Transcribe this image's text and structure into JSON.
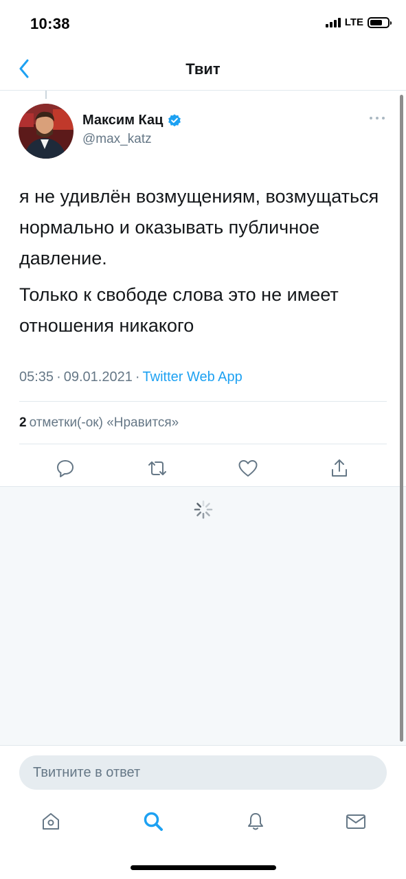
{
  "status_bar": {
    "time": "10:38",
    "network": "LTE"
  },
  "nav": {
    "title": "Твит"
  },
  "tweet": {
    "author_name": "Максим Кац",
    "author_handle": "@max_katz",
    "text_paragraphs": [
      "я не удивлён возмущениям, возмущаться нормально и оказывать публичное давление.",
      "Только к свободе слова это не имеет отношения никакого"
    ],
    "time": "05:35",
    "date": "09.01.2021",
    "source": "Twitter Web App",
    "likes_count": "2",
    "likes_label": "отметки(-ок) «Нравится»"
  },
  "reply": {
    "placeholder": "Твитните в ответ"
  },
  "icons": {
    "back": "chevron-left-icon",
    "verified": "verified-badge-icon",
    "more": "more-horizontal-icon",
    "reply": "reply-icon",
    "retweet": "retweet-icon",
    "like": "heart-icon",
    "share": "share-icon",
    "home": "home-icon",
    "search": "search-icon",
    "notifications": "bell-icon",
    "messages": "mail-icon"
  },
  "colors": {
    "accent": "#1da1f2",
    "text": "#14171a",
    "secondary": "#657786"
  }
}
